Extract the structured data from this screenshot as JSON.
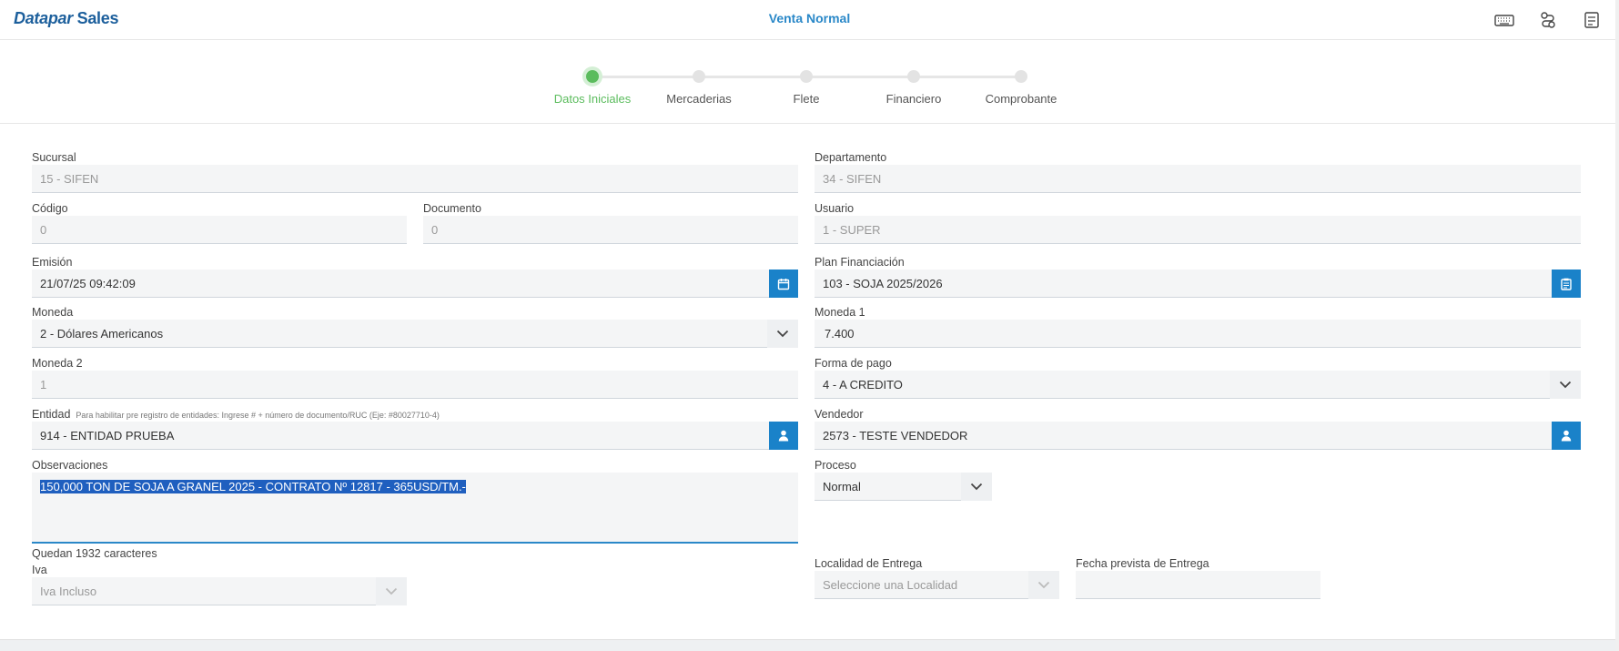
{
  "app": {
    "brand_part1": "Datapar",
    "brand_part2": "Sales",
    "page_title": "Venta Normal"
  },
  "header_icons": [
    "keyboard-icon",
    "route-icon",
    "document-icon"
  ],
  "steps": [
    {
      "label": "Datos Iniciales",
      "active": true
    },
    {
      "label": "Mercaderias",
      "active": false
    },
    {
      "label": "Flete",
      "active": false
    },
    {
      "label": "Financiero",
      "active": false
    },
    {
      "label": "Comprobante",
      "active": false
    }
  ],
  "form": {
    "sucursal": {
      "label": "Sucursal",
      "value": "15 - SIFEN"
    },
    "departamento": {
      "label": "Departamento",
      "value": "34 - SIFEN"
    },
    "codigo": {
      "label": "Código",
      "value": "0"
    },
    "documento": {
      "label": "Documento",
      "value": "0"
    },
    "usuario": {
      "label": "Usuario",
      "value": "1 - SUPER"
    },
    "emision": {
      "label": "Emisión",
      "value": "21/07/25 09:42:09"
    },
    "plan_financiacion": {
      "label": "Plan Financiación",
      "value": "103 - SOJA 2025/2026"
    },
    "moneda": {
      "label": "Moneda",
      "value": "2 - Dólares Americanos"
    },
    "moneda1": {
      "label": "Moneda 1",
      "value": "7.400"
    },
    "moneda2": {
      "label": "Moneda 2",
      "value": "1"
    },
    "forma_pago": {
      "label": "Forma de pago",
      "value": "4 - A CREDITO"
    },
    "entidad": {
      "label": "Entidad",
      "hint": "Para habilitar pre registro de entidades: Ingrese # + número de documento/RUC (Eje: #80027710-4)",
      "value": "914 - ENTIDAD PRUEBA"
    },
    "vendedor": {
      "label": "Vendedor",
      "value": "2573 - TESTE VENDEDOR"
    },
    "observaciones": {
      "label": "Observaciones",
      "value": "150,000 TON DE SOJA A GRANEL  2025 - CONTRATO Nº 12817 - 365USD/TM.-"
    },
    "proceso": {
      "label": "Proceso",
      "value": "Normal"
    },
    "counter": "Quedan 1932 caracteres",
    "iva": {
      "label": "Iva",
      "value": "Iva Incluso"
    },
    "localidad": {
      "label": "Localidad de Entrega",
      "placeholder": "Seleccione una Localidad"
    },
    "fecha_entrega": {
      "label": "Fecha prevista de Entrega",
      "value": ""
    }
  }
}
